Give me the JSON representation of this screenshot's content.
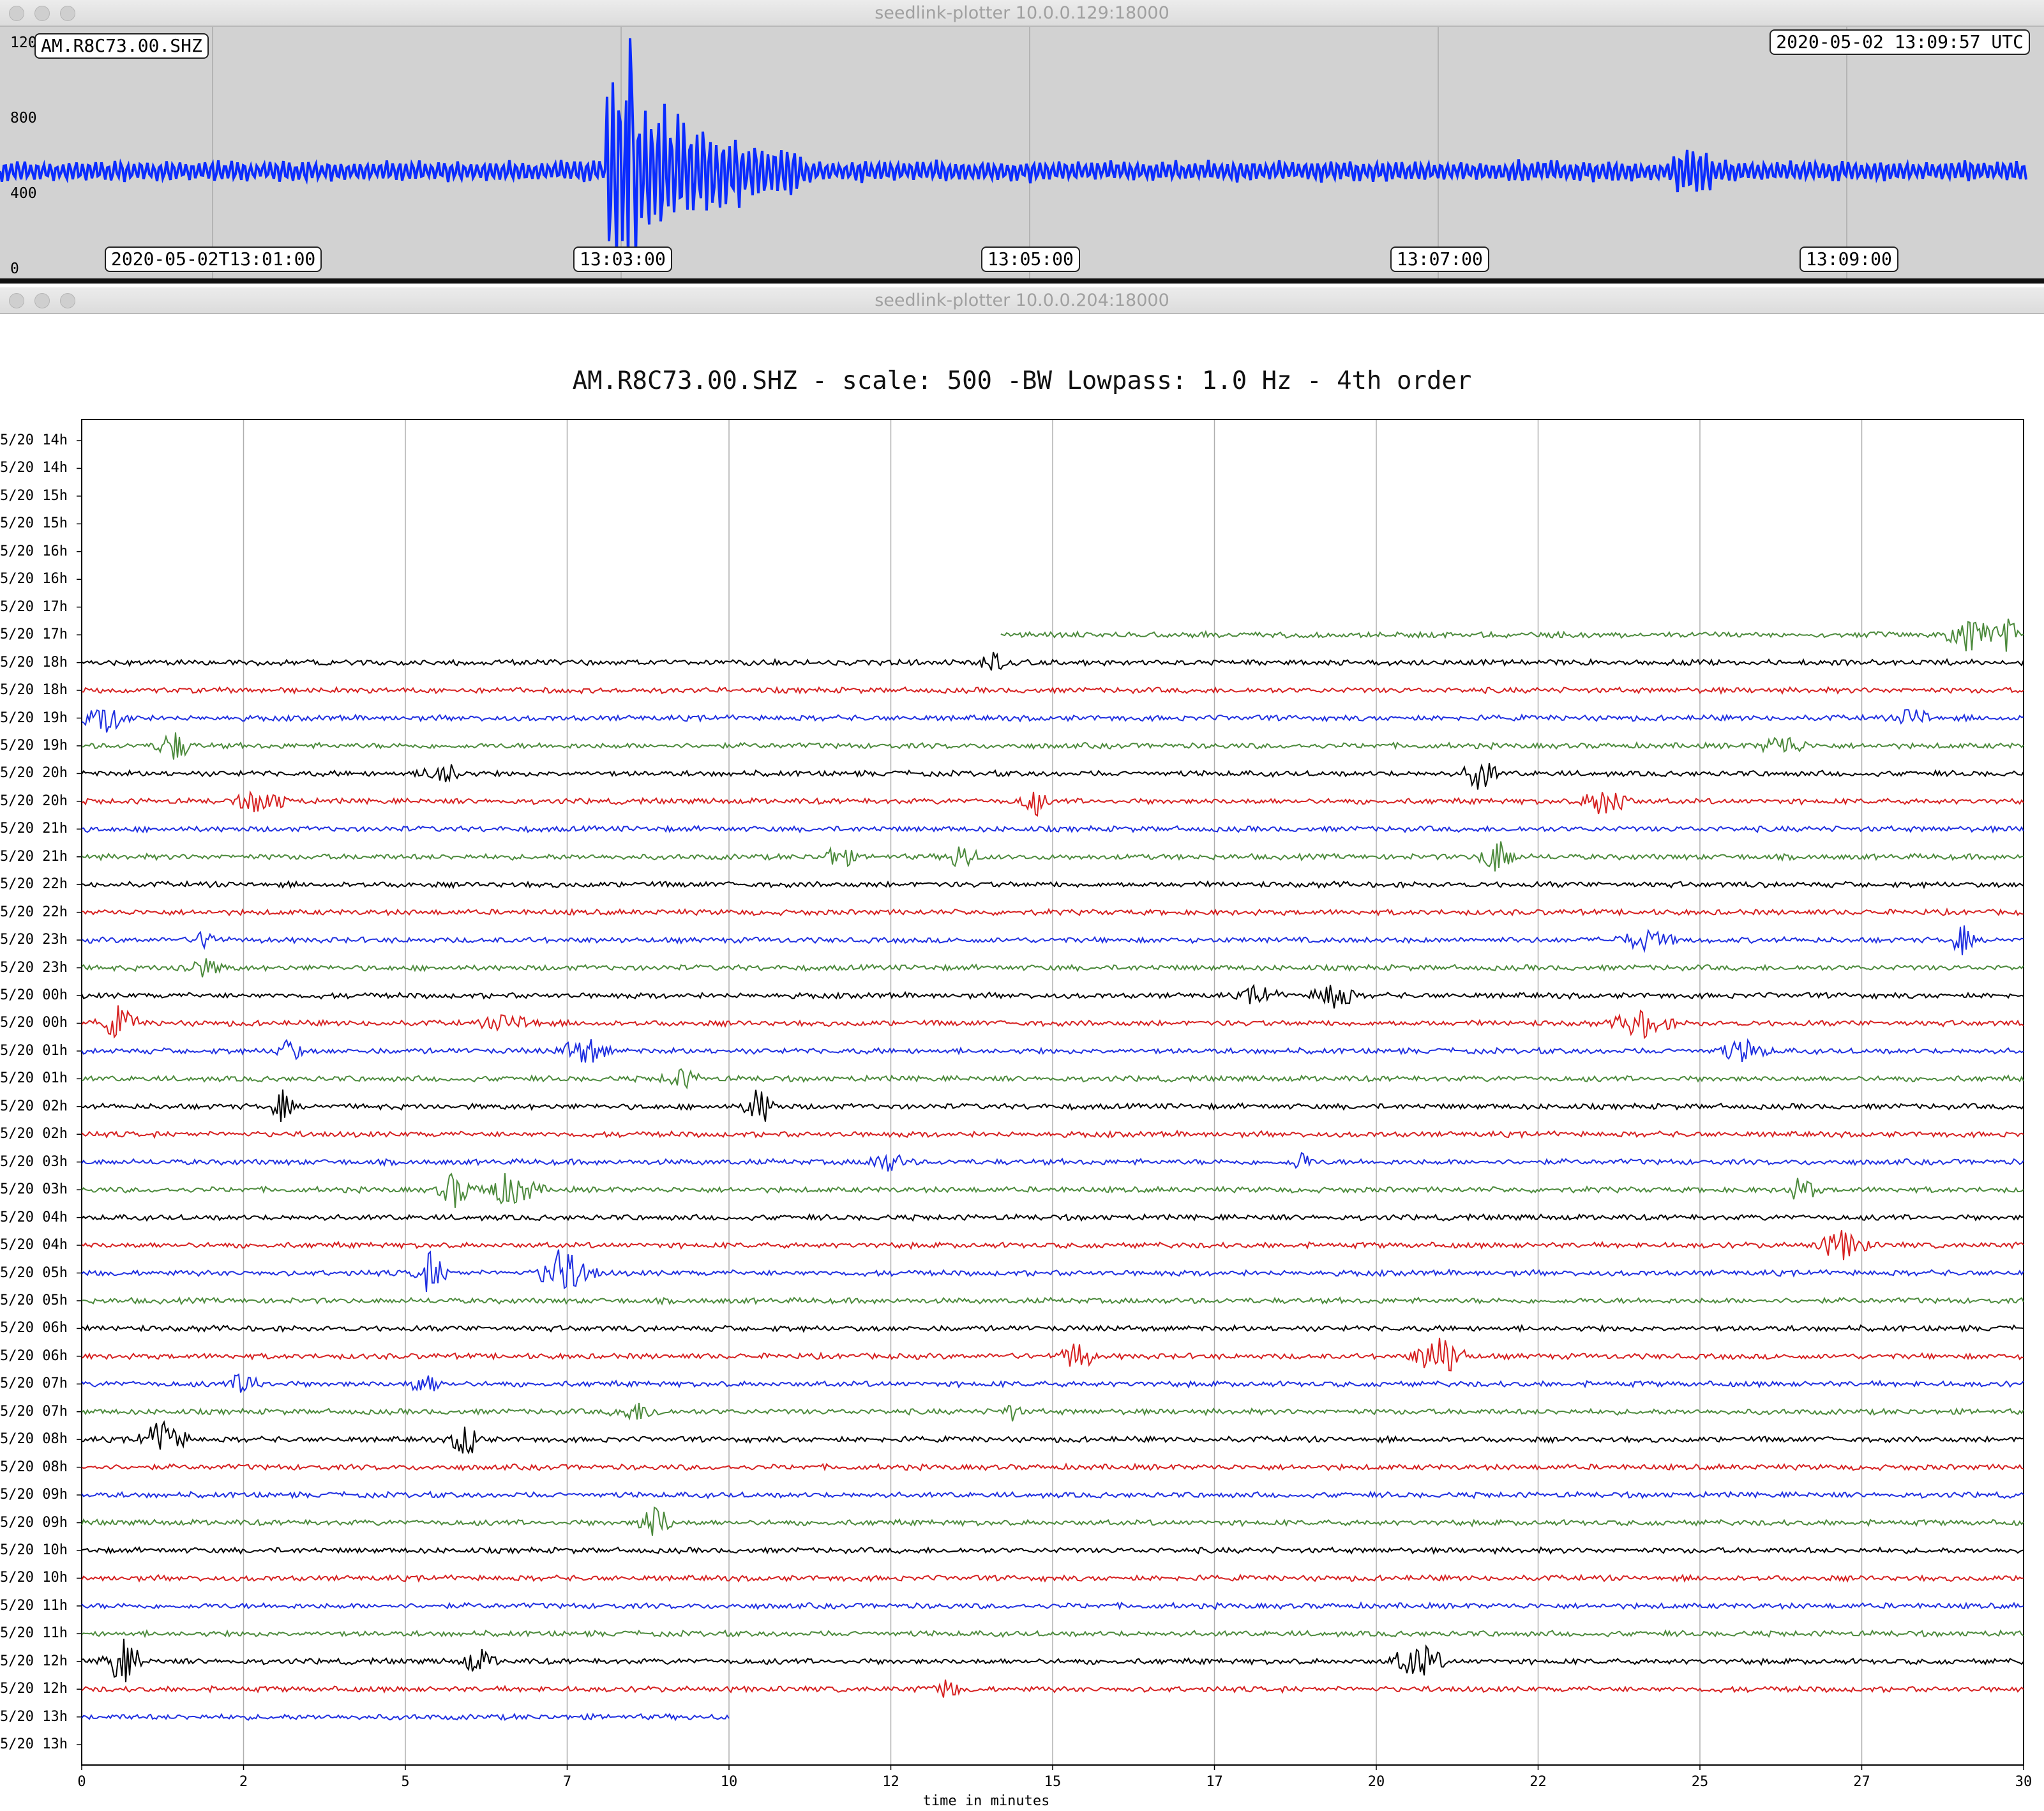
{
  "window_top": {
    "title": "seedlink-plotter 10.0.0.129:18000",
    "station_label": "AM.R8C73.00.SHZ",
    "timestamp_label": "2020-05-02 13:09:57 UTC",
    "y_ticks": [
      "1200",
      "800",
      "400",
      "0"
    ],
    "time_labels": [
      "2020-05-02T13:01:00",
      "13:03:00",
      "13:05:00",
      "13:07:00",
      "13:09:00"
    ],
    "trace_color": "#0a2bff"
  },
  "window_bottom": {
    "title": "seedlink-plotter 10.0.0.204:18000",
    "plot_title": "AM.R8C73.00.SHZ - scale: 500 -BW Lowpass: 1.0 Hz - 4th order",
    "x_axis_label": "time in minutes",
    "x_tick_labels": [
      "0",
      "2",
      "5",
      "7",
      "10",
      "12",
      "15",
      "17",
      "20",
      "22",
      "25",
      "27",
      "30"
    ],
    "row_labels": [
      "5/20 14h",
      "5/20 14h",
      "5/20 15h",
      "5/20 15h",
      "5/20 16h",
      "5/20 16h",
      "5/20 17h",
      "5/20 17h",
      "5/20 18h",
      "5/20 18h",
      "5/20 19h",
      "5/20 19h",
      "5/20 20h",
      "5/20 20h",
      "5/20 21h",
      "5/20 21h",
      "5/20 22h",
      "5/20 22h",
      "5/20 23h",
      "5/20 23h",
      "5/20 00h",
      "5/20 00h",
      "5/20 01h",
      "5/20 01h",
      "5/20 02h",
      "5/20 02h",
      "5/20 03h",
      "5/20 03h",
      "5/20 04h",
      "5/20 04h",
      "5/20 05h",
      "5/20 05h",
      "5/20 06h",
      "5/20 06h",
      "5/20 07h",
      "5/20 07h",
      "5/20 08h",
      "5/20 08h",
      "5/20 09h",
      "5/20 09h",
      "5/20 10h",
      "5/20 10h",
      "5/20 11h",
      "5/20 11h",
      "5/20 12h",
      "5/20 12h",
      "5/20 13h",
      "5/20 13h"
    ],
    "trace_colors": [
      "#000000",
      "#d62020",
      "#1f2fe0",
      "#4c8a3c"
    ]
  },
  "chart_data": {
    "type": "line",
    "title": "AM.R8C73.00.SHZ - scale: 500 -BW Lowpass: 1.0 Hz - 4th order",
    "xlabel": "time in minutes",
    "ylabel": "",
    "xlim": [
      0,
      30
    ],
    "rows": 48,
    "traces": [
      {
        "row": 7,
        "start_min": 14.2,
        "end_min": 30,
        "color": "green"
      },
      {
        "row": 8,
        "start_min": 0,
        "end_min": 30,
        "color": "black"
      },
      {
        "row": 46,
        "start_min": 0,
        "end_min": 10,
        "color": "blue"
      },
      {
        "row": 47,
        "start_min": 0,
        "end_min": 0,
        "color": "red"
      }
    ]
  }
}
